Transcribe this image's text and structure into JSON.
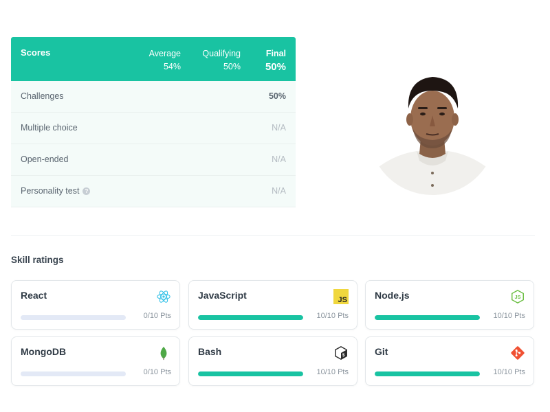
{
  "scores": {
    "header": {
      "label": "Scores",
      "average_label": "Average",
      "average_value": "54%",
      "qualifying_label": "Qualifying",
      "qualifying_value": "50%",
      "final_label": "Final",
      "final_value": "50%"
    },
    "rows": [
      {
        "name": "Challenges",
        "value": "50%"
      },
      {
        "name": "Multiple choice",
        "value": "N/A"
      },
      {
        "name": "Open-ended",
        "value": "N/A"
      },
      {
        "name": "Personality test",
        "value": "N/A"
      }
    ]
  },
  "skills": {
    "title": "Skill ratings",
    "items": [
      {
        "name": "React",
        "points": "0/10 Pts",
        "progress": 0,
        "icon": "react-icon"
      },
      {
        "name": "JavaScript",
        "points": "10/10 Pts",
        "progress": 1,
        "icon": "javascript-icon"
      },
      {
        "name": "Node.js",
        "points": "10/10 Pts",
        "progress": 1,
        "icon": "nodejs-icon"
      },
      {
        "name": "MongoDB",
        "points": "0/10 Pts",
        "progress": 0,
        "icon": "mongodb-icon"
      },
      {
        "name": "Bash",
        "points": "10/10 Pts",
        "progress": 1,
        "icon": "bash-icon"
      },
      {
        "name": "Git",
        "points": "10/10 Pts",
        "progress": 1,
        "icon": "git-icon"
      }
    ]
  },
  "colors": {
    "accent": "#19c3a2",
    "row_bg": "#f4fbf9",
    "bar_track": "#e3e9f6"
  }
}
